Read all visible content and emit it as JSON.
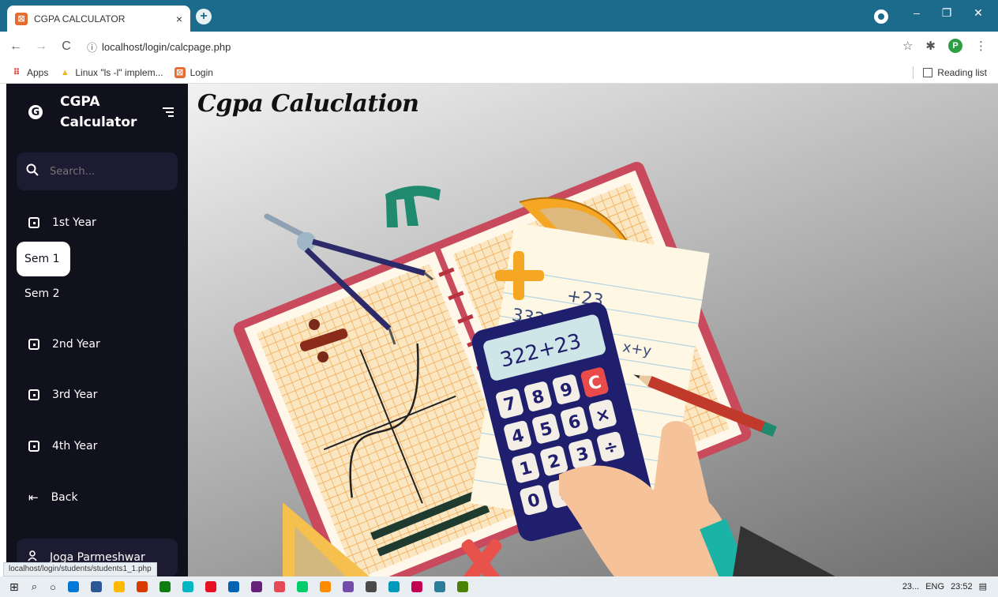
{
  "browser": {
    "tab_title": "CGPA CALCULATOR",
    "tab_close": "×",
    "new_tab": "+",
    "url_info": "ⓘ",
    "url": "localhost/login/calcpage.php",
    "back": "←",
    "forward": "→",
    "reload": "C",
    "star": "☆",
    "extensions": "✱",
    "profile_letter": "P",
    "menu": "⋮",
    "win_minimize": "–",
    "win_restore": "❐",
    "win_close": "✕",
    "bookmarks": [
      {
        "label": "Apps",
        "icon": "apps-grid-icon",
        "glyph": "⠿"
      },
      {
        "label": "Linux \"ls -l\" implem...",
        "icon": "linux-icon",
        "glyph": "▲"
      },
      {
        "label": "Login",
        "icon": "login-favicon",
        "glyph": "⊠"
      }
    ],
    "reading_list": "Reading list"
  },
  "sidebar": {
    "logo": "G",
    "brand_line1": "CGPA",
    "brand_line2": "Calculator",
    "search_placeholder": "Search...",
    "items": [
      {
        "label": "1st Year"
      },
      {
        "label": "2nd Year"
      },
      {
        "label": "3rd Year"
      },
      {
        "label": "4th Year"
      },
      {
        "label": "Back"
      }
    ],
    "sem_active": "Sem 1",
    "sem2": "Sem 2",
    "user_name": "Joga Parmeshwar"
  },
  "main": {
    "title": "Cgpa Caluclation",
    "calculator_display": "322+23",
    "handwriting_top": "+23",
    "handwriting_mid": "332",
    "handwriting_side": "x+y",
    "keys": [
      "7",
      "8",
      "9",
      "C",
      "×",
      "4",
      "5",
      "6",
      "÷",
      "1",
      "2",
      "3",
      "0",
      "."
    ]
  },
  "status_tip": "localhost/login/students/students1_1.php",
  "taskbar": {
    "tray_text": "23...",
    "language": "ENG",
    "time": "23:52",
    "colors": [
      "#0078d7",
      "#2b5797",
      "#ffb900",
      "#d83b01",
      "#107c10",
      "#00b7c3",
      "#e81123",
      "#0063b1",
      "#68217a",
      "#e74856",
      "#00cc6a",
      "#ff8c00",
      "#744da9",
      "#4c4a48",
      "#0099bc",
      "#c30052",
      "#2d7d9a",
      "#498205"
    ]
  },
  "colors": {
    "tabbar": "#1c6a8c",
    "sidebar": "#11101d",
    "sidebar_field": "#1d1b31"
  }
}
